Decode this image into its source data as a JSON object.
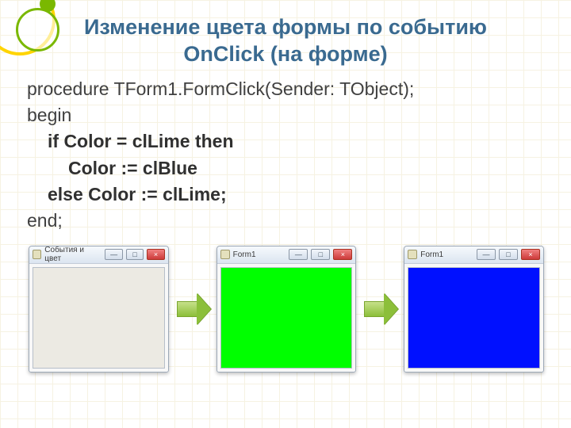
{
  "title_line1": "Изменение цвета формы по событию",
  "title_line2": "OnClick (на форме)",
  "code": {
    "l1": "procedure TForm1.FormClick(Sender: TObject);",
    "l2": "begin",
    "l3": "if Color = clLime then",
    "l4": "Color := clBlue",
    "l5": "else Color := clLime;",
    "l6": "end;"
  },
  "windows": {
    "w1_title": "События и цвет",
    "w2_title": "Form1",
    "w3_title": "Form1",
    "btn_min": "—",
    "btn_max": "□",
    "btn_close": "×"
  }
}
